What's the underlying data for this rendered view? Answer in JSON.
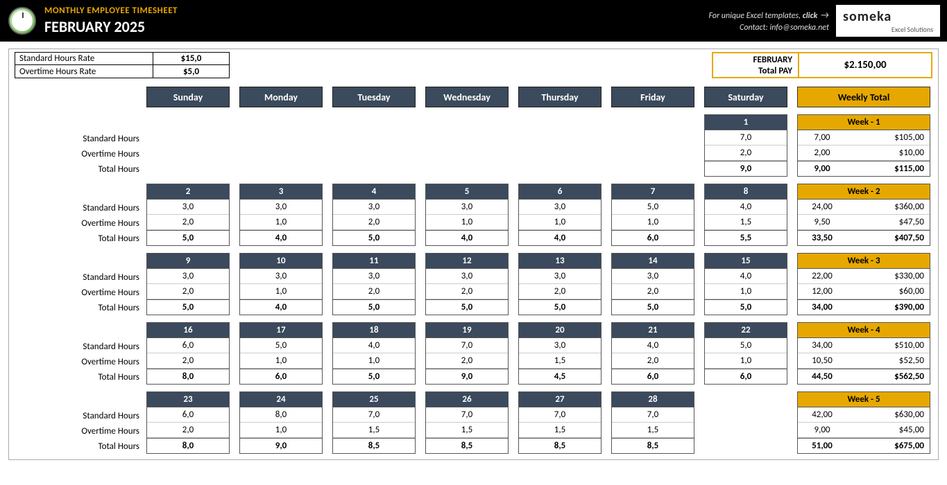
{
  "header": {
    "title_small": "MONTHLY EMPLOYEE TIMESHEET",
    "title_large": "FEBRUARY 2025",
    "promo_prefix": "For unique Excel templates, ",
    "promo_link": "click",
    "contact_label": "Contact: info@someka.net",
    "brand_name": "someka",
    "brand_sub": "Excel Solutions"
  },
  "rates": {
    "standard_label": "Standard Hours Rate",
    "standard_value": "$15,0",
    "overtime_label": "Overtime Hours Rate",
    "overtime_value": "$5,0"
  },
  "total_pay": {
    "label_line1": "FEBRUARY",
    "label_line2": "Total PAY",
    "value": "$2.150,00"
  },
  "day_headers": [
    "Sunday",
    "Monday",
    "Tuesday",
    "Wednesday",
    "Thursday",
    "Friday",
    "Saturday"
  ],
  "weekly_total_header": "Weekly Total",
  "row_labels": {
    "standard": "Standard Hours",
    "overtime": "Overtime Hours",
    "total": "Total Hours"
  },
  "weeks": [
    {
      "title": "Week - 1",
      "days": [
        null,
        null,
        null,
        null,
        null,
        null,
        {
          "num": "1",
          "std": "7,0",
          "ot": "2,0",
          "tot": "9,0"
        }
      ],
      "sum": {
        "std_h": "7,00",
        "std_p": "$105,00",
        "ot_h": "2,00",
        "ot_p": "$10,00",
        "tot_h": "9,00",
        "tot_p": "$115,00"
      }
    },
    {
      "title": "Week - 2",
      "days": [
        {
          "num": "2",
          "std": "3,0",
          "ot": "2,0",
          "tot": "5,0"
        },
        {
          "num": "3",
          "std": "3,0",
          "ot": "1,0",
          "tot": "4,0"
        },
        {
          "num": "4",
          "std": "3,0",
          "ot": "2,0",
          "tot": "5,0"
        },
        {
          "num": "5",
          "std": "3,0",
          "ot": "1,0",
          "tot": "4,0"
        },
        {
          "num": "6",
          "std": "3,0",
          "ot": "1,0",
          "tot": "4,0"
        },
        {
          "num": "7",
          "std": "5,0",
          "ot": "1,0",
          "tot": "6,0"
        },
        {
          "num": "8",
          "std": "4,0",
          "ot": "1,5",
          "tot": "5,5"
        }
      ],
      "sum": {
        "std_h": "24,00",
        "std_p": "$360,00",
        "ot_h": "9,50",
        "ot_p": "$47,50",
        "tot_h": "33,50",
        "tot_p": "$407,50"
      }
    },
    {
      "title": "Week - 3",
      "days": [
        {
          "num": "9",
          "std": "3,0",
          "ot": "2,0",
          "tot": "5,0"
        },
        {
          "num": "10",
          "std": "3,0",
          "ot": "1,0",
          "tot": "4,0"
        },
        {
          "num": "11",
          "std": "3,0",
          "ot": "2,0",
          "tot": "5,0"
        },
        {
          "num": "12",
          "std": "3,0",
          "ot": "2,0",
          "tot": "5,0"
        },
        {
          "num": "13",
          "std": "3,0",
          "ot": "2,0",
          "tot": "5,0"
        },
        {
          "num": "14",
          "std": "3,0",
          "ot": "2,0",
          "tot": "5,0"
        },
        {
          "num": "15",
          "std": "4,0",
          "ot": "1,0",
          "tot": "5,0"
        }
      ],
      "sum": {
        "std_h": "22,00",
        "std_p": "$330,00",
        "ot_h": "12,00",
        "ot_p": "$60,00",
        "tot_h": "34,00",
        "tot_p": "$390,00"
      }
    },
    {
      "title": "Week - 4",
      "days": [
        {
          "num": "16",
          "std": "6,0",
          "ot": "2,0",
          "tot": "8,0"
        },
        {
          "num": "17",
          "std": "5,0",
          "ot": "1,0",
          "tot": "6,0"
        },
        {
          "num": "18",
          "std": "4,0",
          "ot": "1,0",
          "tot": "5,0"
        },
        {
          "num": "19",
          "std": "7,0",
          "ot": "2,0",
          "tot": "9,0"
        },
        {
          "num": "20",
          "std": "3,0",
          "ot": "1,5",
          "tot": "4,5"
        },
        {
          "num": "21",
          "std": "4,0",
          "ot": "2,0",
          "tot": "6,0"
        },
        {
          "num": "22",
          "std": "5,0",
          "ot": "1,0",
          "tot": "6,0"
        }
      ],
      "sum": {
        "std_h": "34,00",
        "std_p": "$510,00",
        "ot_h": "10,50",
        "ot_p": "$52,50",
        "tot_h": "44,50",
        "tot_p": "$562,50"
      }
    },
    {
      "title": "Week - 5",
      "days": [
        {
          "num": "23",
          "std": "6,0",
          "ot": "2,0",
          "tot": "8,0"
        },
        {
          "num": "24",
          "std": "8,0",
          "ot": "1,0",
          "tot": "9,0"
        },
        {
          "num": "25",
          "std": "7,0",
          "ot": "1,5",
          "tot": "8,5"
        },
        {
          "num": "26",
          "std": "7,0",
          "ot": "1,5",
          "tot": "8,5"
        },
        {
          "num": "27",
          "std": "7,0",
          "ot": "1,5",
          "tot": "8,5"
        },
        {
          "num": "28",
          "std": "7,0",
          "ot": "1,5",
          "tot": "8,5"
        },
        null
      ],
      "sum": {
        "std_h": "42,00",
        "std_p": "$630,00",
        "ot_h": "9,00",
        "ot_p": "$45,00",
        "tot_h": "51,00",
        "tot_p": "$675,00"
      }
    }
  ]
}
